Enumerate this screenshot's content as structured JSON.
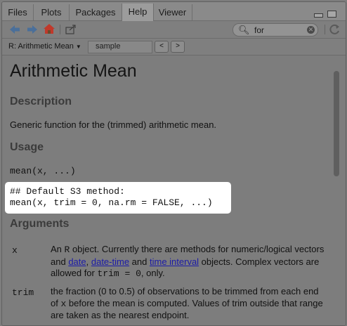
{
  "tabs": [
    {
      "label": "Files",
      "active": false
    },
    {
      "label": "Plots",
      "active": false
    },
    {
      "label": "Packages",
      "active": false
    },
    {
      "label": "Help",
      "active": true
    },
    {
      "label": "Viewer",
      "active": false
    }
  ],
  "toolbar": {
    "icons": [
      "back-arrow-icon",
      "forward-arrow-icon",
      "home-icon",
      "popout-icon",
      "refresh-icon"
    ],
    "search_value": "for"
  },
  "navbar": {
    "topic_label": "R: Arithmetic Mean",
    "find_value": "sample",
    "prev_label": "<",
    "next_label": ">"
  },
  "doc": {
    "title": "Arithmetic Mean",
    "description_heading": "Description",
    "description_text": "Generic function for the (trimmed) arithmetic mean.",
    "usage_heading": "Usage",
    "usage_line": "mean(x, ...)",
    "s3_comment": "## Default S3 method:",
    "s3_call": "mean(x, trim = 0, na.rm = FALSE, ...)",
    "arguments_heading": "Arguments",
    "arg_x": {
      "name": "x",
      "p1": "An ",
      "code1": "R",
      "p2": " object. Currently there are methods for numeric/logical vectors and ",
      "link_date": "date",
      "p3": ", ",
      "link_datetime": "date-time",
      "p4": " and ",
      "link_interval": "time interval",
      "p5": " objects. Complex vectors are allowed for ",
      "code2": "trim = 0",
      "p6": ", only."
    },
    "arg_trim": {
      "name": "trim",
      "p1": "the fraction (0 to 0.5) of observations to be trimmed from each end of ",
      "code1": "x",
      "p2": " before the mean is computed. Values of trim outside that range are taken as the nearest endpoint."
    }
  },
  "colors": {
    "panel_bg": "#7d7d7d",
    "highlight_bg": "#ffffff",
    "link": "#1b1ba8",
    "home_icon": "#c0392b",
    "nav_arrow": "#4a6f9a"
  }
}
